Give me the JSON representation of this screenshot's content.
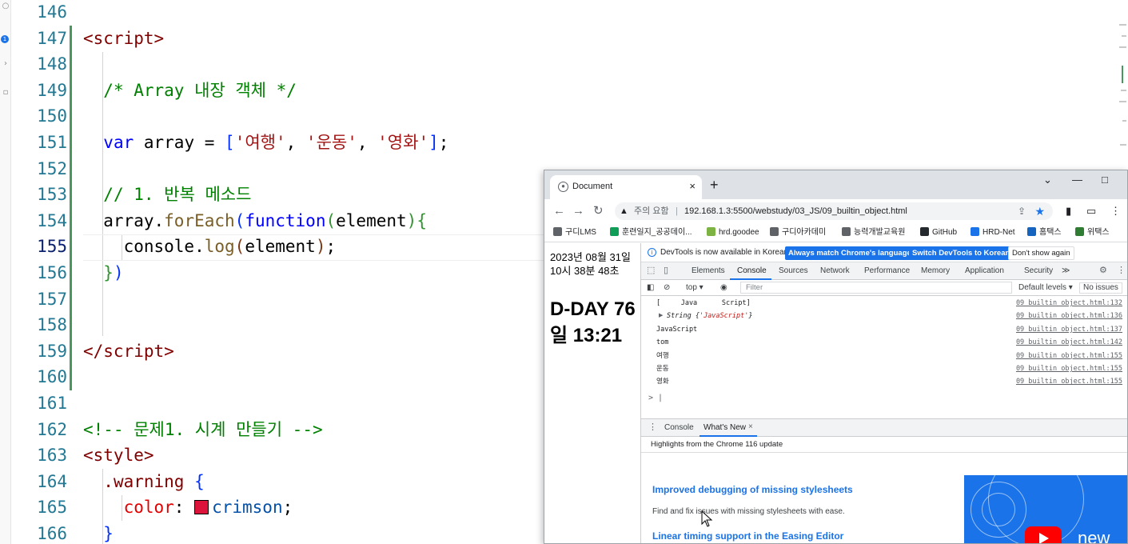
{
  "editor": {
    "lines": [
      {
        "n": "146",
        "html": ""
      },
      {
        "n": "147",
        "html": "<span class='tag'>&lt;script&gt;</span>"
      },
      {
        "n": "148",
        "html": ""
      },
      {
        "n": "149",
        "html": "  <span class='cmt'>/* Array 내장 객체 */</span>"
      },
      {
        "n": "150",
        "html": ""
      },
      {
        "n": "151",
        "html": "  <span class='kw'>var</span> array = <span class='brace1'>[</span><span class='str'>'여행'</span>, <span class='str'>'운동'</span>, <span class='str'>'영화'</span><span class='brace1'>]</span>;"
      },
      {
        "n": "152",
        "html": ""
      },
      {
        "n": "153",
        "html": "  <span class='cmt'>// 1. 반복 메소드</span>"
      },
      {
        "n": "154",
        "html": "  array.<span class='fn'>forEach</span><span class='brace1'>(</span><span class='kw'>function</span><span class='brace2'>(</span>element<span class='brace2'>)</span><span class='brace2'>{</span>"
      },
      {
        "n": "155",
        "html": "    console.<span class='fn'>log</span><span class='brace3'>(</span>element<span class='brace3'>)</span>;"
      },
      {
        "n": "156",
        "html": "  <span class='brace2'>}</span><span class='brace1'>)</span>"
      },
      {
        "n": "157",
        "html": ""
      },
      {
        "n": "158",
        "html": ""
      },
      {
        "n": "159",
        "html": "<span class='tag'>&lt;/script&gt;</span>"
      },
      {
        "n": "160",
        "html": ""
      },
      {
        "n": "161",
        "html": ""
      },
      {
        "n": "162",
        "html": "<span class='cmt'>&lt;!-- 문제1. 시계 만들기 --&gt;</span>"
      },
      {
        "n": "163",
        "html": "<span class='tag'>&lt;style&gt;</span>"
      },
      {
        "n": "164",
        "html": "  <span class='cls'>.warning</span> <span class='brace1'>{</span>"
      },
      {
        "n": "165",
        "html": "    <span class='prop'>color</span>: <span class='swatch'></span><span class='val'>crimson</span>;"
      },
      {
        "n": "166",
        "html": "  <span class='brace1'>}</span>"
      }
    ],
    "current_line": "155",
    "swatch_color": "#dc143c",
    "activity_badge": "1"
  },
  "browser": {
    "tab_title": "Document",
    "tab_close": "×",
    "new_tab": "+",
    "window_buttons": {
      "dropdown": "⌄",
      "minimize": "—",
      "maximize": "□"
    },
    "security_label": "주의 요함",
    "url": "192.168.1.3:5500/webstudy/03_JS/09_builtin_object.html",
    "bookmarks": [
      "구디LMS",
      "훈련일지_공공데이...",
      "hrd.goodee",
      "구디아카데미",
      "능력개발교육원",
      "GitHub",
      "HRD-Net",
      "홈택스",
      "위택스"
    ],
    "bookmark_colors": [
      "#5f6368",
      "#0f9d58",
      "#7cb342",
      "#5f6368",
      "#5f6368",
      "#24292e",
      "#1a73e8",
      "#1565c0",
      "#2e7d32"
    ]
  },
  "page": {
    "clock": "2023년 08월 31일 10시 38분 48초",
    "dday": "D-DAY 76일 13:21"
  },
  "devtools": {
    "infobar_text": "DevTools is now available in Korean!",
    "btn_match": "Always match Chrome's language",
    "btn_switch": "Switch DevTools to Korean",
    "btn_dont_show": "Don't show again",
    "tabs": [
      "Elements",
      "Console",
      "Sources",
      "Network",
      "Performance",
      "Memory",
      "Application",
      "Security"
    ],
    "active_tab": "Console",
    "more_tabs": "≫",
    "context": "top",
    "filter_placeholder": "Filter",
    "levels": "Default levels",
    "issues": "No issues",
    "log": [
      {
        "msg": "[     Java      Script]",
        "src": "09_builtin_object.html:132",
        "kind": "plain"
      },
      {
        "msg": "String {'JavaScript'}",
        "src": "09_builtin_object.html:136",
        "kind": "obj"
      },
      {
        "msg": "JavaScript",
        "src": "09_builtin_object.html:137",
        "kind": "plain"
      },
      {
        "msg": "tom",
        "src": "09_builtin_object.html:142",
        "kind": "plain"
      },
      {
        "msg": "여행",
        "src": "09_builtin_object.html:155",
        "kind": "plain"
      },
      {
        "msg": "운동",
        "src": "09_builtin_object.html:155",
        "kind": "plain"
      },
      {
        "msg": "영화",
        "src": "09_builtin_object.html:155",
        "kind": "plain"
      }
    ],
    "prompt": "> |",
    "drawer_tabs": [
      "Console",
      "What's New"
    ],
    "drawer_close": "×",
    "whats_new_header": "Highlights from the Chrome 116 update",
    "items": [
      {
        "title": "Improved debugging of missing stylesheets",
        "desc": "Find and fix issues with missing stylesheets with ease."
      },
      {
        "title": "Linear timing support in the Easing Editor",
        "desc": ""
      }
    ],
    "thumb_text": "new"
  }
}
